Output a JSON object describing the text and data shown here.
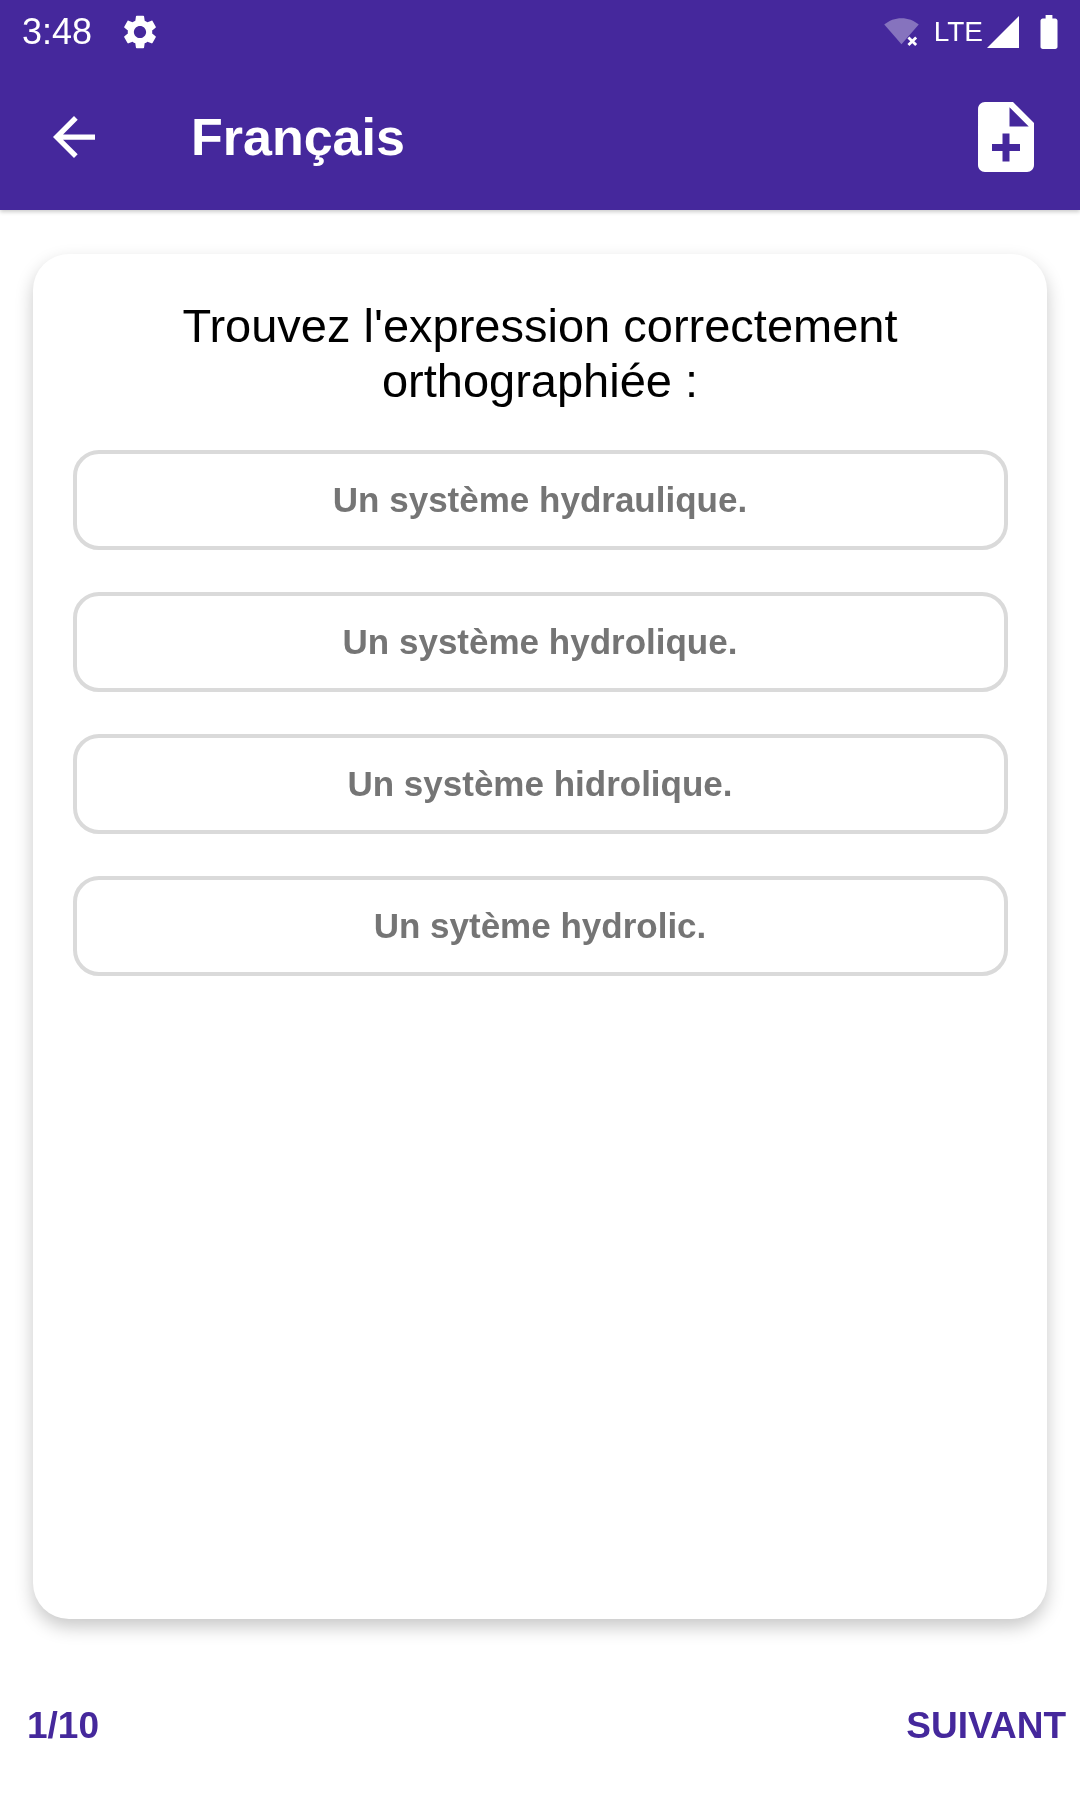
{
  "status_bar": {
    "time": "3:48",
    "network": "LTE"
  },
  "app_bar": {
    "title": "Français"
  },
  "question": {
    "prompt": "Trouvez l'expression correctement orthographiée :",
    "options": [
      {
        "label": "Un système hydraulique."
      },
      {
        "label": "Un système hydrolique."
      },
      {
        "label": "Un système hidrolique."
      },
      {
        "label": "Un sytème hydrolic."
      }
    ]
  },
  "footer": {
    "progress": "1/10",
    "next": "SUIVANT"
  }
}
